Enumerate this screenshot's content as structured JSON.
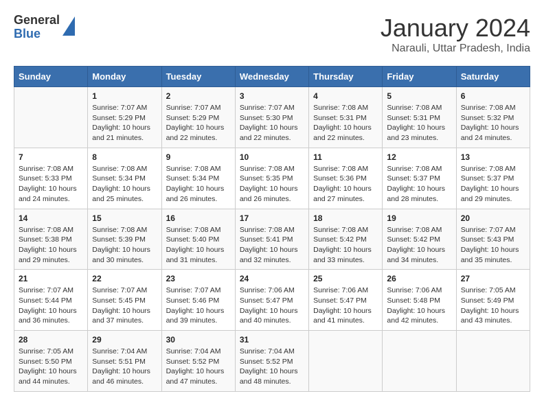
{
  "logo": {
    "line1": "General",
    "line2": "Blue"
  },
  "title": "January 2024",
  "subtitle": "Narauli, Uttar Pradesh, India",
  "days_of_week": [
    "Sunday",
    "Monday",
    "Tuesday",
    "Wednesday",
    "Thursday",
    "Friday",
    "Saturday"
  ],
  "weeks": [
    [
      {
        "num": "",
        "info": ""
      },
      {
        "num": "1",
        "info": "Sunrise: 7:07 AM\nSunset: 5:29 PM\nDaylight: 10 hours\nand 21 minutes."
      },
      {
        "num": "2",
        "info": "Sunrise: 7:07 AM\nSunset: 5:29 PM\nDaylight: 10 hours\nand 22 minutes."
      },
      {
        "num": "3",
        "info": "Sunrise: 7:07 AM\nSunset: 5:30 PM\nDaylight: 10 hours\nand 22 minutes."
      },
      {
        "num": "4",
        "info": "Sunrise: 7:08 AM\nSunset: 5:31 PM\nDaylight: 10 hours\nand 22 minutes."
      },
      {
        "num": "5",
        "info": "Sunrise: 7:08 AM\nSunset: 5:31 PM\nDaylight: 10 hours\nand 23 minutes."
      },
      {
        "num": "6",
        "info": "Sunrise: 7:08 AM\nSunset: 5:32 PM\nDaylight: 10 hours\nand 24 minutes."
      }
    ],
    [
      {
        "num": "7",
        "info": "Sunrise: 7:08 AM\nSunset: 5:33 PM\nDaylight: 10 hours\nand 24 minutes."
      },
      {
        "num": "8",
        "info": "Sunrise: 7:08 AM\nSunset: 5:34 PM\nDaylight: 10 hours\nand 25 minutes."
      },
      {
        "num": "9",
        "info": "Sunrise: 7:08 AM\nSunset: 5:34 PM\nDaylight: 10 hours\nand 26 minutes."
      },
      {
        "num": "10",
        "info": "Sunrise: 7:08 AM\nSunset: 5:35 PM\nDaylight: 10 hours\nand 26 minutes."
      },
      {
        "num": "11",
        "info": "Sunrise: 7:08 AM\nSunset: 5:36 PM\nDaylight: 10 hours\nand 27 minutes."
      },
      {
        "num": "12",
        "info": "Sunrise: 7:08 AM\nSunset: 5:37 PM\nDaylight: 10 hours\nand 28 minutes."
      },
      {
        "num": "13",
        "info": "Sunrise: 7:08 AM\nSunset: 5:37 PM\nDaylight: 10 hours\nand 29 minutes."
      }
    ],
    [
      {
        "num": "14",
        "info": "Sunrise: 7:08 AM\nSunset: 5:38 PM\nDaylight: 10 hours\nand 29 minutes."
      },
      {
        "num": "15",
        "info": "Sunrise: 7:08 AM\nSunset: 5:39 PM\nDaylight: 10 hours\nand 30 minutes."
      },
      {
        "num": "16",
        "info": "Sunrise: 7:08 AM\nSunset: 5:40 PM\nDaylight: 10 hours\nand 31 minutes."
      },
      {
        "num": "17",
        "info": "Sunrise: 7:08 AM\nSunset: 5:41 PM\nDaylight: 10 hours\nand 32 minutes."
      },
      {
        "num": "18",
        "info": "Sunrise: 7:08 AM\nSunset: 5:42 PM\nDaylight: 10 hours\nand 33 minutes."
      },
      {
        "num": "19",
        "info": "Sunrise: 7:08 AM\nSunset: 5:42 PM\nDaylight: 10 hours\nand 34 minutes."
      },
      {
        "num": "20",
        "info": "Sunrise: 7:07 AM\nSunset: 5:43 PM\nDaylight: 10 hours\nand 35 minutes."
      }
    ],
    [
      {
        "num": "21",
        "info": "Sunrise: 7:07 AM\nSunset: 5:44 PM\nDaylight: 10 hours\nand 36 minutes."
      },
      {
        "num": "22",
        "info": "Sunrise: 7:07 AM\nSunset: 5:45 PM\nDaylight: 10 hours\nand 37 minutes."
      },
      {
        "num": "23",
        "info": "Sunrise: 7:07 AM\nSunset: 5:46 PM\nDaylight: 10 hours\nand 39 minutes."
      },
      {
        "num": "24",
        "info": "Sunrise: 7:06 AM\nSunset: 5:47 PM\nDaylight: 10 hours\nand 40 minutes."
      },
      {
        "num": "25",
        "info": "Sunrise: 7:06 AM\nSunset: 5:47 PM\nDaylight: 10 hours\nand 41 minutes."
      },
      {
        "num": "26",
        "info": "Sunrise: 7:06 AM\nSunset: 5:48 PM\nDaylight: 10 hours\nand 42 minutes."
      },
      {
        "num": "27",
        "info": "Sunrise: 7:05 AM\nSunset: 5:49 PM\nDaylight: 10 hours\nand 43 minutes."
      }
    ],
    [
      {
        "num": "28",
        "info": "Sunrise: 7:05 AM\nSunset: 5:50 PM\nDaylight: 10 hours\nand 44 minutes."
      },
      {
        "num": "29",
        "info": "Sunrise: 7:04 AM\nSunset: 5:51 PM\nDaylight: 10 hours\nand 46 minutes."
      },
      {
        "num": "30",
        "info": "Sunrise: 7:04 AM\nSunset: 5:52 PM\nDaylight: 10 hours\nand 47 minutes."
      },
      {
        "num": "31",
        "info": "Sunrise: 7:04 AM\nSunset: 5:52 PM\nDaylight: 10 hours\nand 48 minutes."
      },
      {
        "num": "",
        "info": ""
      },
      {
        "num": "",
        "info": ""
      },
      {
        "num": "",
        "info": ""
      }
    ]
  ]
}
